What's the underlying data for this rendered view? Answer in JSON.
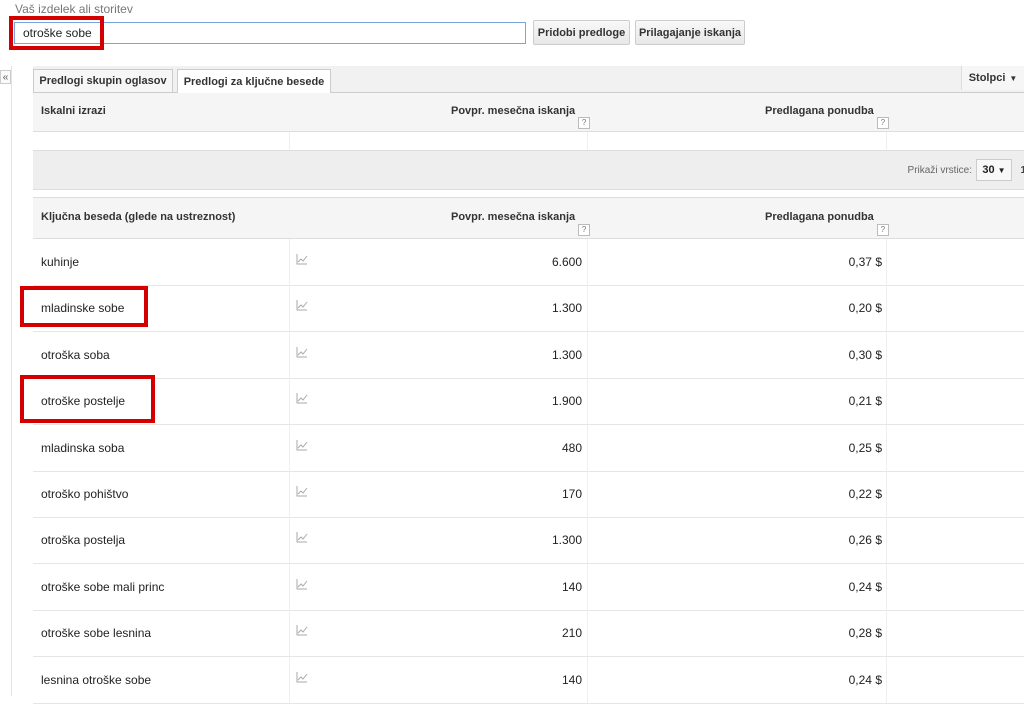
{
  "search": {
    "label": "Vaš izdelek ali storitev",
    "value": "otroške sobe",
    "get_ideas_button": "Pridobi predloge",
    "adjust_button": "Prilagajanje iskanja"
  },
  "collapse_label": "«",
  "tabs": [
    {
      "label": "Predlogi skupin oglasov"
    },
    {
      "label": "Predlogi za ključne besede"
    }
  ],
  "columns_button": "Stolpci",
  "search_terms_header": {
    "col1": "Iskalni izrazi",
    "col2": "Povpr. mesečna iskanja",
    "col3": "Predlagana ponudba",
    "help": "?"
  },
  "rows_control": {
    "label": "Prikaži vrstice:",
    "value": "30",
    "cut_text": "1"
  },
  "keywords_header": {
    "col1": "Ključna beseda (glede na ustreznost)",
    "col2": "Povpr. mesečna iskanja",
    "col3": "Predlagana ponudba",
    "help": "?"
  },
  "keywords": [
    {
      "keyword": "kuhinje",
      "avg": "6.600",
      "bid": "0,37 $"
    },
    {
      "keyword": "mladinske sobe",
      "avg": "1.300",
      "bid": "0,20 $"
    },
    {
      "keyword": "otroška soba",
      "avg": "1.300",
      "bid": "0,30 $"
    },
    {
      "keyword": "otroške postelje",
      "avg": "1.900",
      "bid": "0,21 $"
    },
    {
      "keyword": "mladinska soba",
      "avg": "480",
      "bid": "0,25 $"
    },
    {
      "keyword": "otroško pohištvo",
      "avg": "170",
      "bid": "0,22 $"
    },
    {
      "keyword": "otroška postelja",
      "avg": "1.300",
      "bid": "0,26 $"
    },
    {
      "keyword": "otroške sobe mali princ",
      "avg": "140",
      "bid": "0,24 $"
    },
    {
      "keyword": "otroške sobe lesnina",
      "avg": "210",
      "bid": "0,28 $"
    },
    {
      "keyword": "lesnina otroške sobe",
      "avg": "140",
      "bid": "0,24 $"
    }
  ],
  "highlight_color": "#d40000"
}
